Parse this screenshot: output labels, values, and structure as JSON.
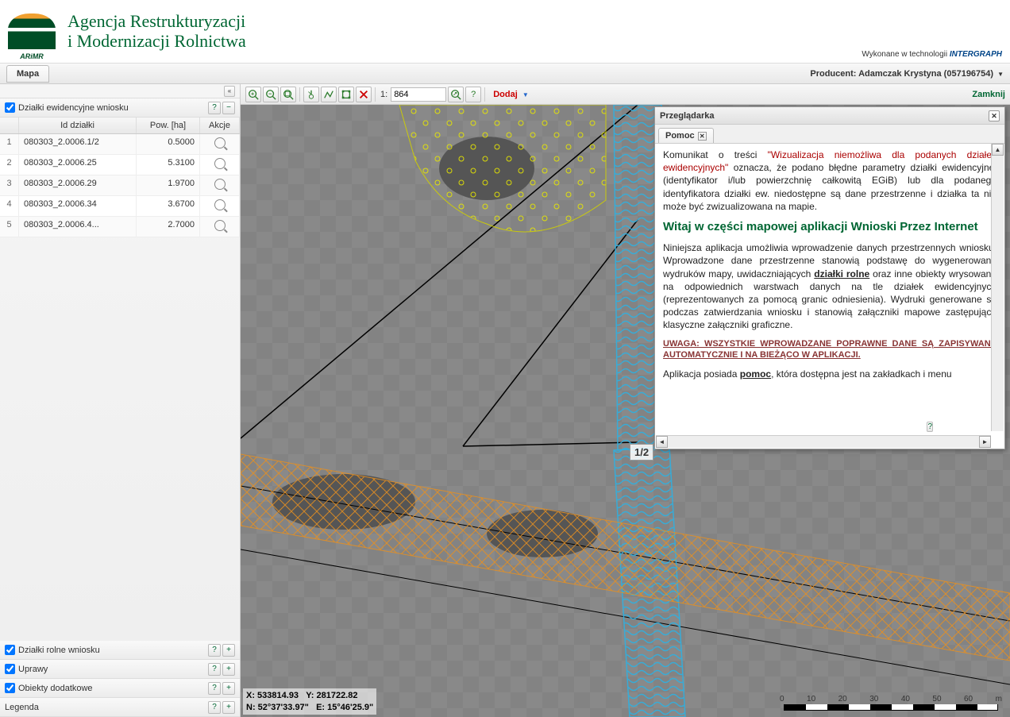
{
  "header": {
    "org_line1": "Agencja Restrukturyzacji",
    "org_line2": "i Modernizacji Rolnictwa",
    "tech_prefix": "Wykonane w technologii ",
    "tech_brand": "INTERGRAPH"
  },
  "topbar": {
    "tab_mapa": "Mapa",
    "producer_label": "Producent: Adamczak Krystyna (057196754)"
  },
  "sidebar": {
    "panel1_title": "Działki ewidencyjne wniosku",
    "columns": {
      "id": "Id działki",
      "pow": "Pow. [ha]",
      "akcje": "Akcje"
    },
    "rows": [
      {
        "n": "1",
        "id": "080303_2.0006.1/2",
        "pow": "0.5000"
      },
      {
        "n": "2",
        "id": "080303_2.0006.25",
        "pow": "5.3100"
      },
      {
        "n": "3",
        "id": "080303_2.0006.29",
        "pow": "1.9700"
      },
      {
        "n": "4",
        "id": "080303_2.0006.34",
        "pow": "3.6700"
      },
      {
        "n": "5",
        "id": "080303_2.0006.4...",
        "pow": "2.7000"
      }
    ],
    "panel2_title": "Działki rolne wniosku",
    "panel3_title": "Uprawy",
    "panel4_title": "Obiekty dodatkowe",
    "panel5_title": "Legenda"
  },
  "toolbar": {
    "scale_prefix": "1:",
    "scale_value": "864",
    "dodaj": "Dodaj",
    "zamknij": "Zamknij"
  },
  "map": {
    "page_indicator": "1/2",
    "coord_x": "X: 533814.93",
    "coord_y": "Y: 281722.82",
    "coord_n": "N: 52°37'33.97\"",
    "coord_e": "E: 15°46'25.9\"",
    "scale_ticks": [
      "0",
      "10",
      "20",
      "30",
      "40",
      "50",
      "60",
      "m"
    ]
  },
  "browser": {
    "title": "Przeglądarka",
    "tab_label": "Pomoc",
    "p1_a": "Komunikat o treści ",
    "p1_quote": "\"Wizualizacja niemożliwa dla podanych działek ewidencyjnych\"",
    "p1_b": " oznacza, że podano błędne parametry działki ewidencyjnej (identyfikator i/lub powierzchnię całkowitą EGiB) lub dla podanego identyfikatora działki ew. niedostępne są dane przestrzenne i działka ta nie może być zwizualizowana na mapie.",
    "h2": "Witaj w części mapowej aplikacji Wnioski Przez Internet",
    "p2_a": "Niniejsza aplikacja umożliwia wprowadzenie danych przestrzennych wniosku. Wprowadzone dane przestrzenne stanowią podstawę do wygenerowana wydruków mapy, uwidaczniających ",
    "p2_u": "działki rolne",
    "p2_b": " oraz inne obiekty wrysowane na odpowiednich warstwach danych na tle działek ewidencyjnych (reprezentowanych za pomocą granic odniesienia). Wydruki generowane są podczas zatwierdzania wniosku i stanowią załączniki mapowe zastępujące klasyczne załączniki graficzne.",
    "warn": "UWAGA: WSZYSTKIE WPROWADZANE POPRAWNE DANE SĄ ZAPISYWANE AUTOMATYCZNIE I NA BIEŻĄCO W APLIKACJI.",
    "p3_a": "Aplikacja posiada ",
    "p3_u": "pomoc",
    "p3_b": ", która dostępna jest na zakładkach i menu"
  }
}
